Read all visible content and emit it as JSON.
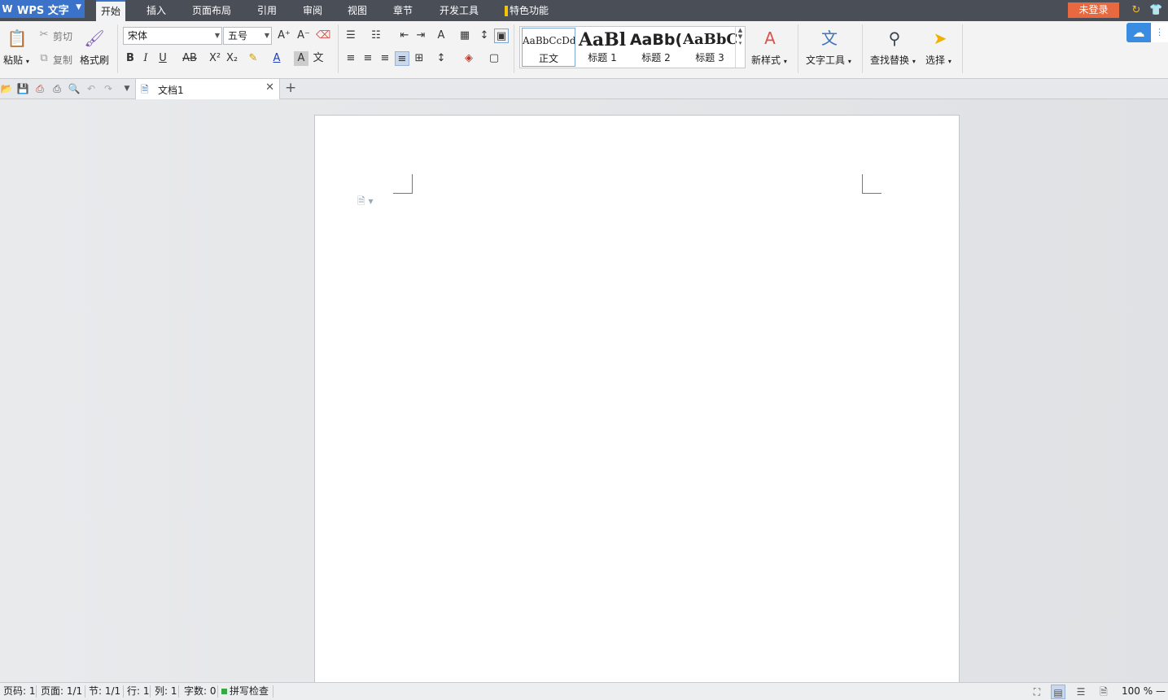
{
  "app": {
    "title": "WPS 文字",
    "login_label": "未登录"
  },
  "menu": {
    "tabs": [
      {
        "label": "开始"
      },
      {
        "label": "插入"
      },
      {
        "label": "页面布局"
      },
      {
        "label": "引用"
      },
      {
        "label": "审阅"
      },
      {
        "label": "视图"
      },
      {
        "label": "章节"
      },
      {
        "label": "开发工具"
      },
      {
        "label": "特色功能"
      }
    ]
  },
  "ribbon": {
    "clipboard": {
      "paste": "粘贴",
      "cut": "剪切",
      "copy": "复制",
      "format_painter": "格式刷"
    },
    "font": {
      "name": "宋体",
      "size": "五号"
    },
    "styles": [
      {
        "sample": "AaBbCcDd",
        "name": "正文"
      },
      {
        "sample": "AaBl",
        "name": "标题 1"
      },
      {
        "sample": "AaBb(",
        "name": "标题 2"
      },
      {
        "sample": "AaBbC",
        "name": "标题 3"
      }
    ],
    "new_style": "新样式",
    "text_tools": "文字工具",
    "find_replace": "查找替换",
    "select": "选择"
  },
  "document": {
    "tab_title": "文档1"
  },
  "status": {
    "page_code": "页码: 1",
    "page": "页面: 1/1",
    "section": "节: 1/1",
    "line": "行: 1",
    "column": "列: 1",
    "word_count": "字数: 0",
    "spell_check": "拼写检查",
    "zoom": "100 %"
  },
  "colors": {
    "accent": "#3a73c9",
    "login": "#e8693f",
    "titlebar": "#4a4f57"
  }
}
